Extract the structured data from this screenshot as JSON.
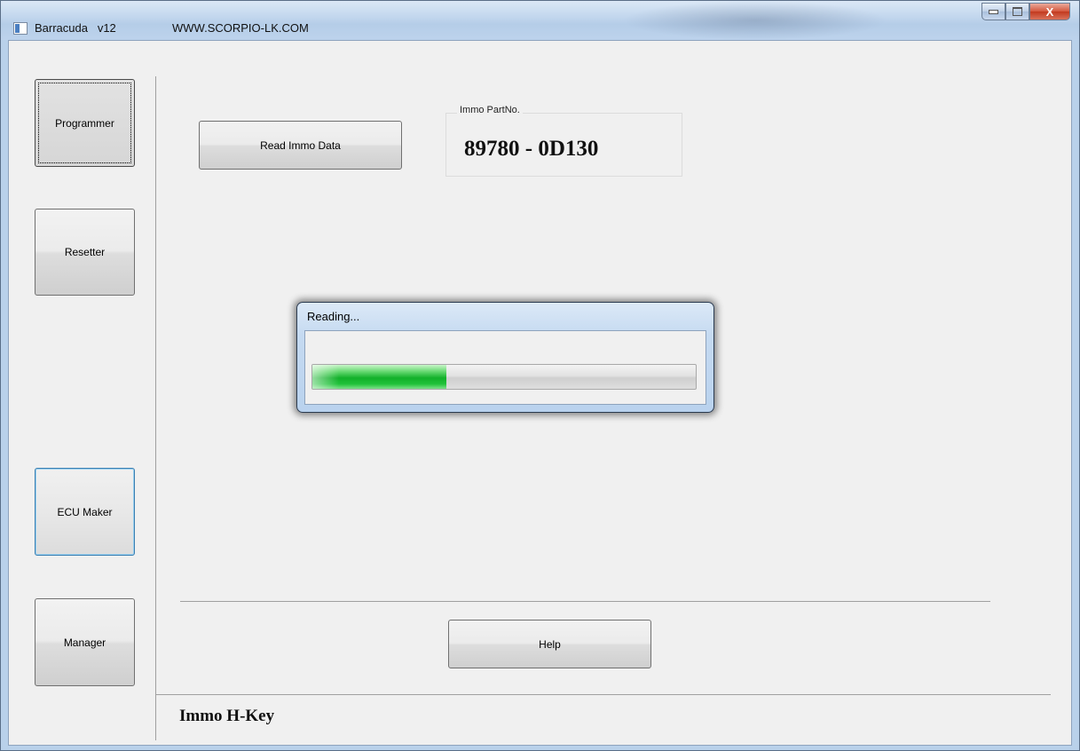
{
  "window": {
    "app_name": "Barracuda   v12",
    "website": "WWW.SCORPIO-LK.COM",
    "close_glyph": "X"
  },
  "sidebar": {
    "items": [
      {
        "label": "Programmer"
      },
      {
        "label": "Resetter"
      },
      {
        "label": "ECU Maker"
      },
      {
        "label": "Manager"
      }
    ]
  },
  "main": {
    "read_button_label": "Read Immo Data",
    "immo_group_label": "Immo PartNo.",
    "immo_part_number": "89780 - 0D130",
    "help_button_label": "Help",
    "footer_title": "Immo H-Key"
  },
  "progress_dialog": {
    "title": "Reading...",
    "progress_fraction": 0.35,
    "fill_color": "#12b02a"
  }
}
